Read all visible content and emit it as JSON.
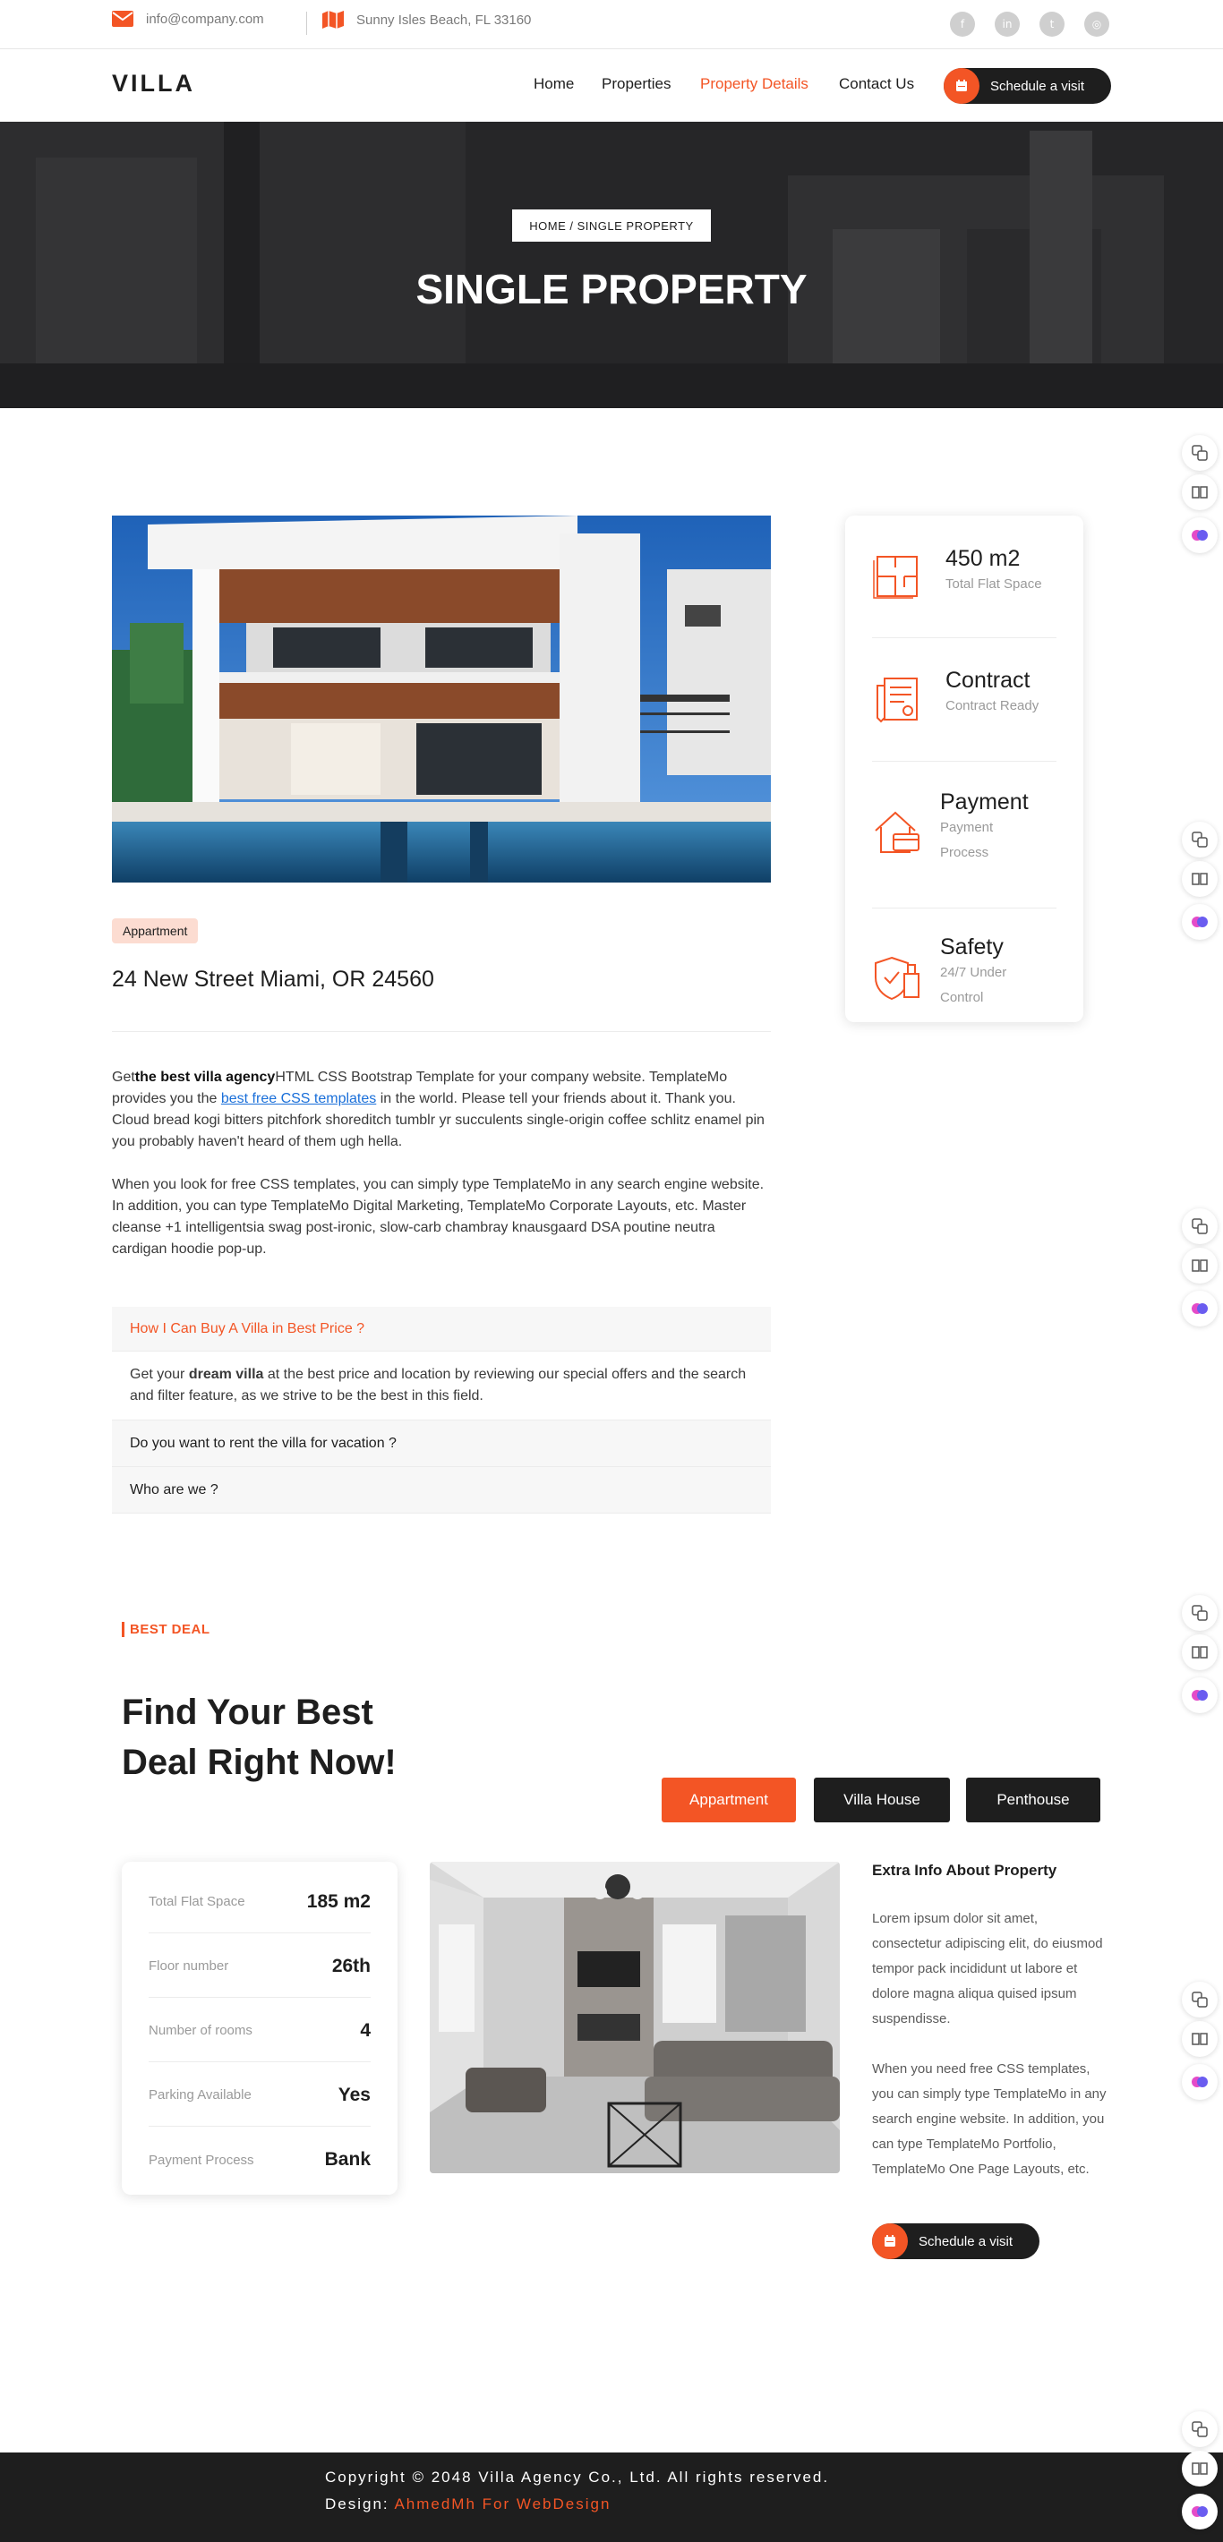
{
  "topbar": {
    "email": "info@company.com",
    "location": "Sunny Isles Beach, FL 33160",
    "social_icons": [
      "facebook-icon",
      "linkedin-icon",
      "twitter-icon",
      "instagram-icon"
    ]
  },
  "header": {
    "logo": "VILLA",
    "nav": [
      "Home",
      "Properties",
      "Property Details",
      "Contact Us"
    ],
    "active_nav": "Property Details",
    "schedule_label": "Schedule a visit"
  },
  "hero": {
    "breadcrumb": "HOME / SINGLE PROPERTY",
    "title": "SINGLE PROPERTY"
  },
  "property": {
    "badge": "Appartment",
    "address": "24 New Street Miami, OR 24560",
    "para1": {
      "pre": "Get",
      "bold": "the best villa agency",
      "mid": "HTML CSS Bootstrap Template for your company website. TemplateMo provides you the ",
      "link": "best free CSS templates",
      "post": " in the world. Please tell your friends about it. Thank you. Cloud bread kogi bitters pitchfork shoreditch tumblr yr succulents single-origin coffee schlitz enamel pin you probably haven't heard of them ugh hella."
    },
    "para2": "When you look for free CSS templates, you can simply type TemplateMo in any search engine website. In addition, you can type TemplateMo Digital Marketing, TemplateMo Corporate Layouts, etc. Master cleanse +1 intelligentsia swag post-ironic, slow-carb chambray knausgaard DSA poutine neutra cardigan hoodie pop-up."
  },
  "accordion": {
    "q1": "How I Can Buy A Villa in Best Price ?",
    "a1_pre": "Get your ",
    "a1_bold": "dream villa",
    "a1_post": " at the best price and location by reviewing our special offers and the search and filter feature, as we strive to be the best in this field.",
    "q2": "Do you want to rent the villa for vacation ?",
    "q3": "Who are we ?"
  },
  "info": [
    {
      "title": "450 m2",
      "sub": "Total Flat Space"
    },
    {
      "title": "Contract",
      "sub": "Contract Ready"
    },
    {
      "title": "Payment",
      "sub1": "Payment",
      "sub2": "Process"
    },
    {
      "title": "Safety",
      "sub1": "24/7 Under",
      "sub2": "Control"
    }
  ],
  "best_deal": {
    "tag": "BEST DEAL",
    "title": "Find Your Best Deal Right Now!",
    "tabs": [
      "Appartment",
      "Villa House",
      "Penthouse"
    ],
    "details": [
      {
        "label": "Total Flat Space",
        "value": "185 m2"
      },
      {
        "label": "Floor number",
        "value": "26th"
      },
      {
        "label": "Number of rooms",
        "value": "4"
      },
      {
        "label": "Parking Available",
        "value": "Yes"
      },
      {
        "label": "Payment Process",
        "value": "Bank"
      }
    ],
    "extra_title": "Extra Info About Property",
    "extra_p1": "Lorem ipsum dolor sit amet, consectetur adipiscing elit, do eiusmod tempor pack incididunt ut labore et dolore magna aliqua quised ipsum suspendisse.",
    "extra_p2": "When you need free CSS templates, you can simply type TemplateMo in any search engine website. In addition, you can type TemplateMo Portfolio, TemplateMo One Page Layouts, etc.",
    "schedule_label": "Schedule a visit"
  },
  "footer": {
    "copyright": "Copyright © 2048 Villa Agency Co., Ltd. All rights reserved.",
    "design_label": "Design: ",
    "design_by": "AhmedMh For WebDesign"
  },
  "colors": {
    "accent": "#f35525",
    "dark": "#1e1e1e",
    "badge_bg": "#fcdcd1"
  }
}
